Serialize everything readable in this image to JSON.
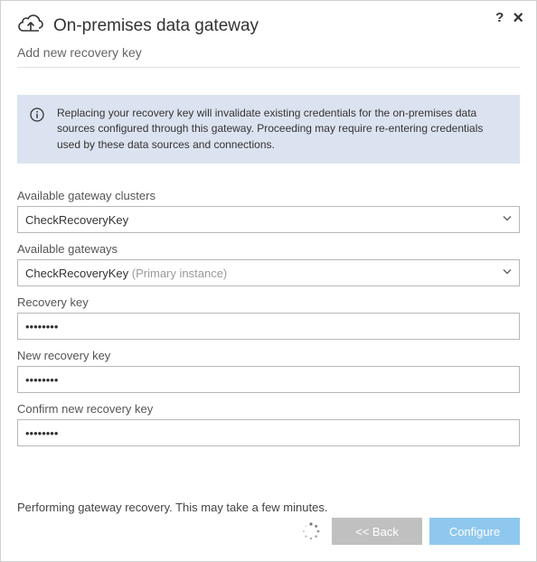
{
  "titlebar": {
    "help_icon": "?",
    "close_icon": "×"
  },
  "header": {
    "title": "On-premises data gateway",
    "subtitle": "Add new recovery key"
  },
  "info": {
    "text": "Replacing your recovery key will invalidate existing credentials for the on-premises data sources configured through this gateway. Proceeding may require re-entering credentials used by these data sources and connections."
  },
  "fields": {
    "clusters": {
      "label": "Available gateway clusters",
      "value": "CheckRecoveryKey"
    },
    "gateways": {
      "label": "Available gateways",
      "value": "CheckRecoveryKey",
      "suffix": "(Primary instance)"
    },
    "recovery_key": {
      "label": "Recovery key",
      "value": "••••••••"
    },
    "new_recovery_key": {
      "label": "New recovery key",
      "value": "••••••••"
    },
    "confirm_recovery_key": {
      "label": "Confirm new recovery key",
      "value": "••••••••"
    }
  },
  "footer": {
    "status": "Performing gateway recovery. This may take a few minutes.",
    "back_label": "<< Back",
    "configure_label": "Configure"
  }
}
